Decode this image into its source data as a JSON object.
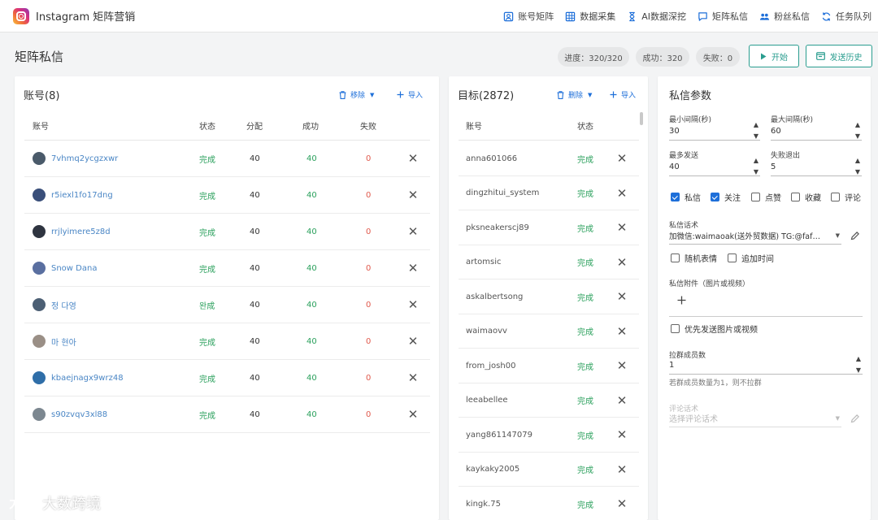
{
  "app": {
    "title": "Instagram 矩阵营销"
  },
  "nav": [
    {
      "label": "账号矩阵",
      "icon": "account-matrix-icon"
    },
    {
      "label": "数据采集",
      "icon": "data-grid-icon"
    },
    {
      "label": "AI数据深挖",
      "icon": "hourglass-icon"
    },
    {
      "label": "矩阵私信",
      "icon": "chat-icon"
    },
    {
      "label": "粉丝私信",
      "icon": "people-icon"
    },
    {
      "label": "任务队列",
      "icon": "sync-icon"
    }
  ],
  "header": {
    "title": "矩阵私信",
    "progress": "进度：320/320",
    "success": "成功：320",
    "failed": "失败：0",
    "start_label": "开始",
    "history_label": "发送历史"
  },
  "accounts": {
    "title": "账号(8)",
    "remove_label": "移除",
    "import_label": "导入",
    "columns": [
      "账号",
      "状态",
      "分配",
      "成功",
      "失败"
    ],
    "rows": [
      {
        "name": "7vhmq2ycgzxwr",
        "status": "完成",
        "assigned": "40",
        "success": "40",
        "failed": "0",
        "avatar_color": "#4a5a6a"
      },
      {
        "name": "r5iexl1fo17dng",
        "status": "完成",
        "assigned": "40",
        "success": "40",
        "failed": "0",
        "avatar_color": "#3a4f7a"
      },
      {
        "name": "rrjlyimere5z8d",
        "status": "完成",
        "assigned": "40",
        "success": "40",
        "failed": "0",
        "avatar_color": "#2e3440"
      },
      {
        "name": "Snow Dana",
        "status": "完成",
        "assigned": "40",
        "success": "40",
        "failed": "0",
        "avatar_color": "#5a6fa0"
      },
      {
        "name": "정 다영",
        "status": "완成",
        "assigned": "40",
        "success": "40",
        "failed": "0",
        "avatar_color": "#4c5f74"
      },
      {
        "name": "마 현아",
        "status": "完成",
        "assigned": "40",
        "success": "40",
        "failed": "0",
        "avatar_color": "#9a8f86"
      },
      {
        "name": "kbaejnagx9wrz48",
        "status": "完成",
        "assigned": "40",
        "success": "40",
        "failed": "0",
        "avatar_color": "#2f6ea8"
      },
      {
        "name": "s90zvqv3xl88",
        "status": "完成",
        "assigned": "40",
        "success": "40",
        "failed": "0",
        "avatar_color": "#7c8790"
      }
    ]
  },
  "targets": {
    "title": "目标(2872)",
    "delete_label": "删除",
    "import_label": "导入",
    "columns": [
      "账号",
      "状态"
    ],
    "rows": [
      {
        "name": "anna601066",
        "status": "完成"
      },
      {
        "name": "dingzhitui_system",
        "status": "完成"
      },
      {
        "name": "pksneakerscj89",
        "status": "完成"
      },
      {
        "name": "artomsic",
        "status": "完成"
      },
      {
        "name": "askalbertsong",
        "status": "完成"
      },
      {
        "name": "waimaovv",
        "status": "完成"
      },
      {
        "name": "from_josh00",
        "status": "完成"
      },
      {
        "name": "leeabellee",
        "status": "完成"
      },
      {
        "name": "yang861147079",
        "status": "完成"
      },
      {
        "name": "kaykaky2005",
        "status": "完成"
      },
      {
        "name": "kingk.75",
        "status": "完成"
      }
    ]
  },
  "params": {
    "title": "私信参数",
    "min_interval_label": "最小间隔(秒)",
    "min_interval": "30",
    "max_interval_label": "最大间隔(秒)",
    "max_interval": "60",
    "max_send_label": "最多发送",
    "max_send": "40",
    "fail_exit_label": "失败退出",
    "fail_exit": "5",
    "options": [
      {
        "label": "私信",
        "checked": true
      },
      {
        "label": "关注",
        "checked": true
      },
      {
        "label": "点赞",
        "checked": false
      },
      {
        "label": "收藏",
        "checked": false
      },
      {
        "label": "评论",
        "checked": false
      }
    ],
    "script_label": "私信话术",
    "script_value": "加微信:waimaoak(送外贸数据)  TG:@faf…",
    "random_emoji_label": "随机表情",
    "append_time_label": "追加时间",
    "attachment_label": "私信附件（图片或视频）",
    "priority_media_label": "优先发送图片或视频",
    "group_members_label": "拉群成员数",
    "group_members": "1",
    "group_hint": "若群成员数量为1，则不拉群",
    "comment_script_label": "评论话术",
    "comment_script_placeholder": "选择评论话术"
  },
  "watermark": {
    "text": "大数跨境"
  },
  "colors": {
    "accent": "#2a9d8f",
    "link": "#1e6fd9",
    "success": "#2aa05c",
    "danger": "#e05a4d"
  }
}
